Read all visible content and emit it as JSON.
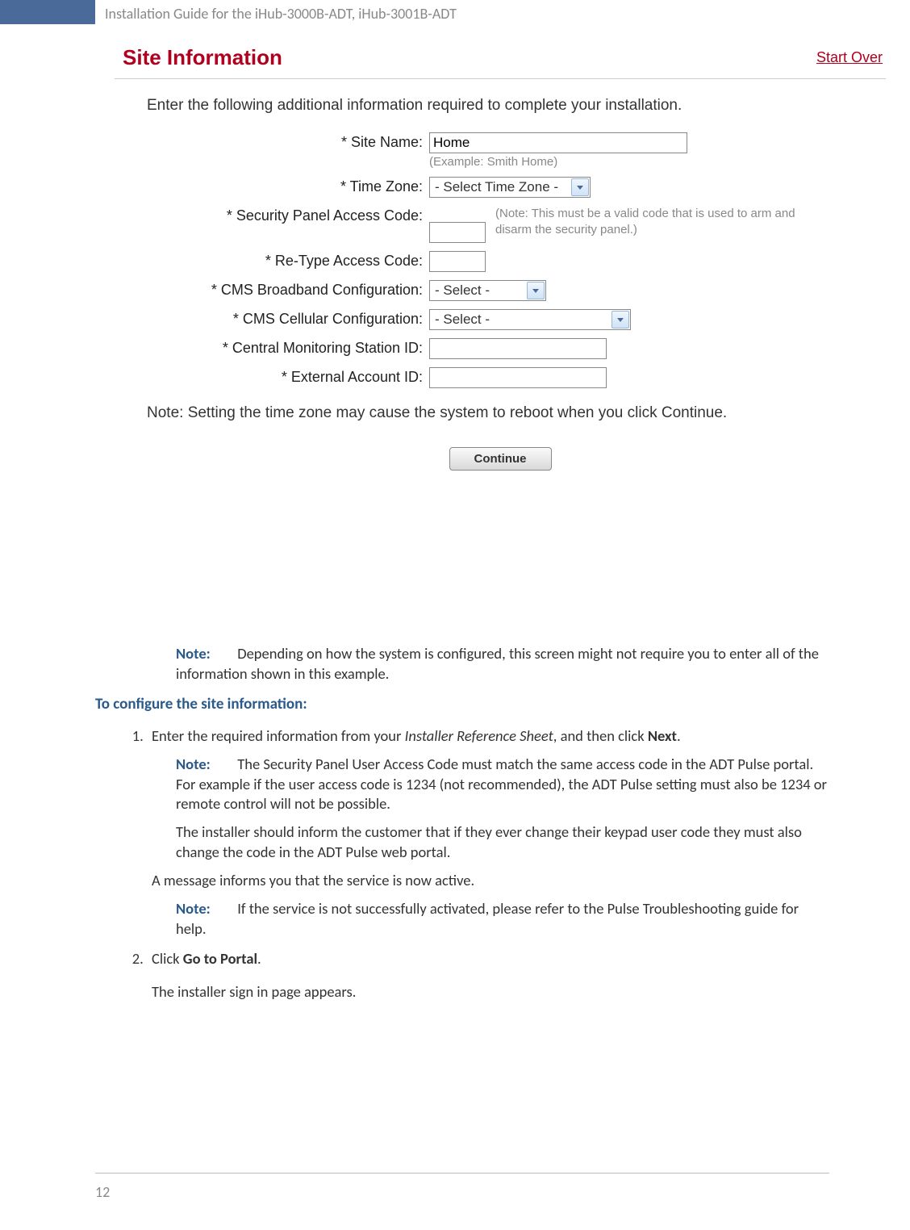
{
  "header": {
    "title": "Installation Guide for the iHub-3000B-ADT, iHub-3001B-ADT"
  },
  "screenshot": {
    "title": "Site Information",
    "start_over": "Start Over",
    "intro": "Enter the following additional information required to complete your installation.",
    "fields": {
      "site_name": {
        "label": "* Site Name:",
        "value": "Home",
        "example": "(Example: Smith Home)"
      },
      "time_zone": {
        "label": "* Time Zone:",
        "value": "- Select Time Zone -"
      },
      "access_code": {
        "label": "* Security Panel Access Code:",
        "note": "(Note: This must be a valid code that is used to arm and disarm the security panel.)"
      },
      "retype_code": {
        "label": "* Re-Type Access Code:"
      },
      "cms_broadband": {
        "label": "* CMS Broadband Configuration:",
        "value": "- Select -"
      },
      "cms_cellular": {
        "label": "* CMS Cellular Configuration:",
        "value": "- Select -"
      },
      "cms_id": {
        "label": "* Central Monitoring Station ID:"
      },
      "ext_account": {
        "label": "* External Account ID:"
      }
    },
    "bottom_note": "Note: Setting the time zone may cause the system to reboot when you click Continue.",
    "continue": "Continue"
  },
  "doc": {
    "note_label": "Note:",
    "note1": "Depending on how the system is configured, this screen might not require you to enter all of the information shown in this example.",
    "section_h": "To configure the site information:",
    "step1_a": "Enter the required information from your ",
    "step1_em": "Installer Reference Sheet",
    "step1_b": ", and then click ",
    "step1_bold": "Next",
    "step1_c": ".",
    "note2": "The Security Panel User Access Code must match the same access code in the ADT Pulse portal. For example if the user access code is 1234 (not recommended), the ADT Pulse setting must also be 1234 or remote control will not be possible.",
    "note2b": "The installer should inform the customer that if they ever change their keypad user code they must also change the code in the ADT Pulse web portal.",
    "after1": "A message informs you that the service is now active.",
    "note3": "If the service is not successfully activated, please refer to the Pulse Troubleshooting guide for help.",
    "step2_a": "Click ",
    "step2_bold": "Go to Portal",
    "step2_b": ".",
    "after2": "The installer sign in page appears."
  },
  "page_number": "12"
}
